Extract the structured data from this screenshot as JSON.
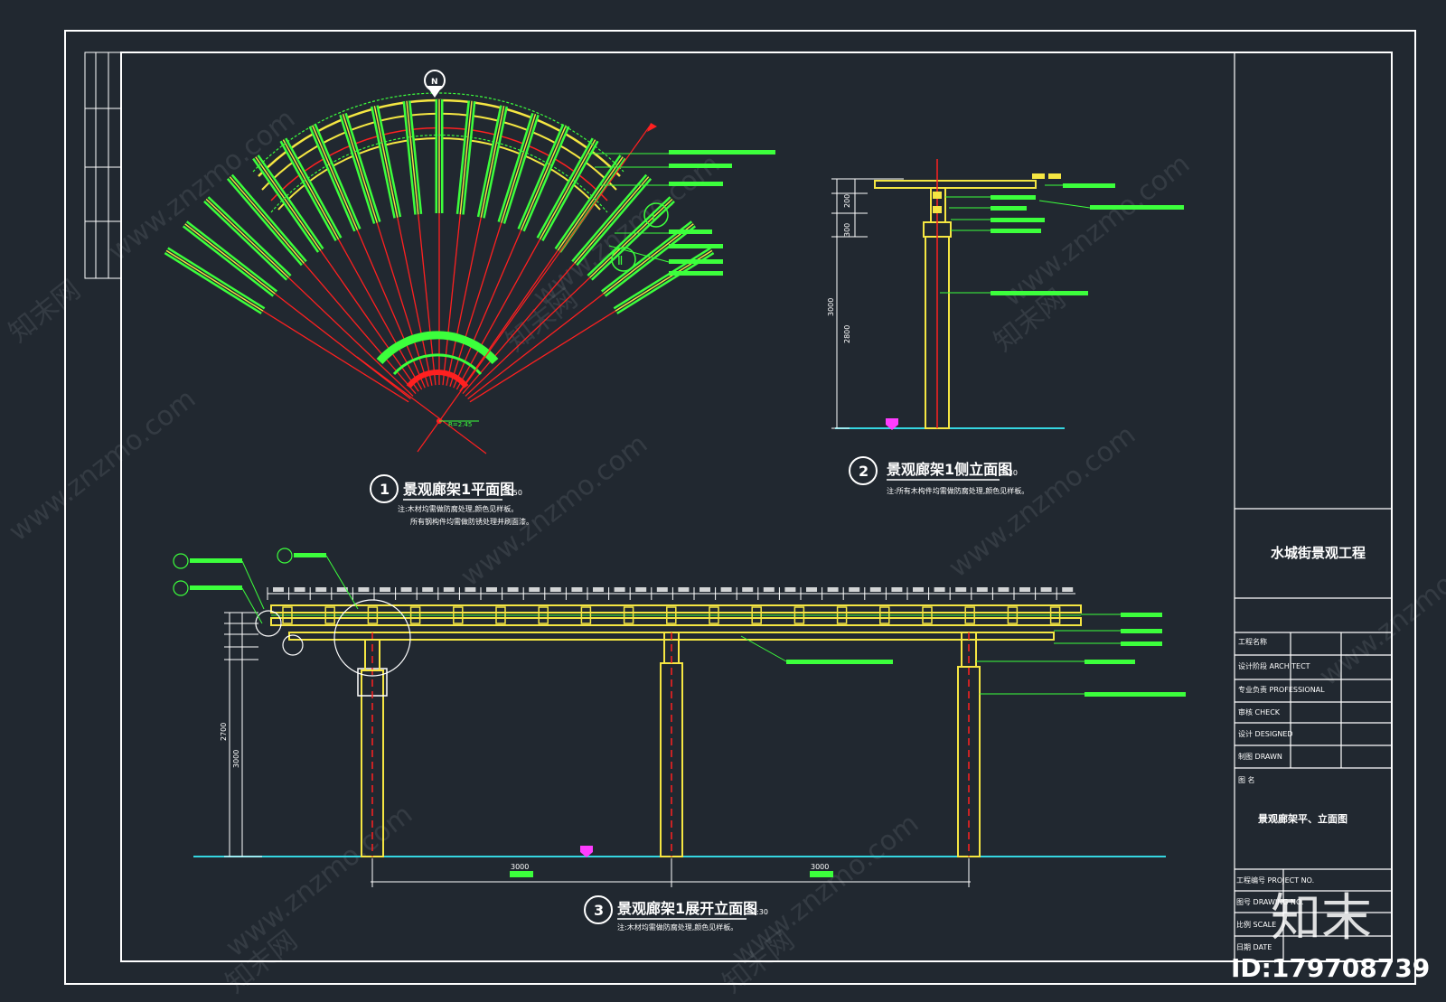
{
  "north_marker": "N",
  "plan": {
    "num": "1",
    "title": "景观廊架1平面图",
    "scale": "1:50",
    "notes": [
      "注:木材均需做防腐处理,颜色见样板。",
      "所有钢构件均需做防锈处理并刷面漆。"
    ],
    "callouts": [
      "Ⅰ",
      "Ⅱ"
    ]
  },
  "elev1": {
    "num": "2",
    "title": "景观廊架1侧立面图",
    "scale": "1:30",
    "notes": [
      "注:所有木构件均需做防腐处理,颜色见样板。"
    ],
    "dims": [
      "200",
      "300",
      "3000",
      "2800"
    ]
  },
  "elev2": {
    "num": "3",
    "title": "景观廊架1展开立面图",
    "scale": "1:30",
    "notes": [
      "注:木材均需做防腐处理,颜色见样板。"
    ],
    "dims": [
      "3000",
      "3000"
    ],
    "height_dims": [
      "2700",
      "3000"
    ]
  },
  "title_block": {
    "project": "水城街景观工程",
    "rows": [
      "工程名称",
      "设计阶段 ARCHITECT",
      "专业负责 PROFESSIONAL",
      "审核 CHECK",
      "设计 DESIGNED",
      "制图 DRAWN"
    ],
    "drawing_label": "图  名",
    "drawing_name": "景观廊架平、立面图",
    "bottom_rows": [
      "工程编号 PROJECT NO.",
      "图号 DRAWING NO.",
      "比例 SCALE",
      "日期 DATE"
    ]
  },
  "watermark": "www.znzmo.com",
  "watermark_cn": "知末网",
  "brand": "知末",
  "id_label": "ID:179708739",
  "colors": {
    "background": "#212830",
    "border": "#ffffff",
    "wood": "#f5e642",
    "annotation": "#3cff3c",
    "centerline": "#ff2020",
    "ground": "#35d6e0",
    "marker": "#ff3cff"
  }
}
